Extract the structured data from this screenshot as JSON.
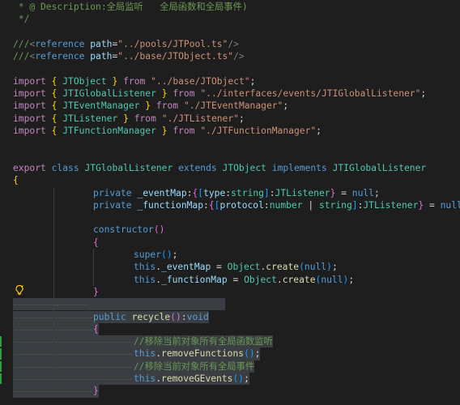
{
  "editor": {
    "lines": [
      {
        "name": "code-line-description",
        "tokens": [
          {
            "c": "c-comment",
            "t": " * @ Description:全局监听   全局函数和全局事件)"
          }
        ]
      },
      {
        "name": "code-line-comment-close",
        "tokens": [
          {
            "c": "c-comment",
            "t": " */"
          }
        ]
      },
      {
        "name": "code-line-blank",
        "tokens": []
      },
      {
        "name": "code-line-reference-pool",
        "tokens": [
          {
            "c": "c-comment",
            "t": "///"
          },
          {
            "c": "c-tag",
            "t": "<"
          },
          {
            "c": "c-storage",
            "t": "reference"
          },
          {
            "c": "c-plain",
            "t": " "
          },
          {
            "c": "c-attr",
            "t": "path"
          },
          {
            "c": "c-plain",
            "t": "="
          },
          {
            "c": "c-str",
            "t": "\"../pools/JTPool.ts\""
          },
          {
            "c": "c-tag",
            "t": "/>"
          }
        ]
      },
      {
        "name": "code-line-reference-object",
        "tokens": [
          {
            "c": "c-comment",
            "t": "///"
          },
          {
            "c": "c-tag",
            "t": "<"
          },
          {
            "c": "c-storage",
            "t": "reference"
          },
          {
            "c": "c-plain",
            "t": " "
          },
          {
            "c": "c-attr",
            "t": "path"
          },
          {
            "c": "c-plain",
            "t": "="
          },
          {
            "c": "c-str",
            "t": "\"../base/JTObject.ts\""
          },
          {
            "c": "c-tag",
            "t": "/>"
          }
        ]
      },
      {
        "name": "code-line-blank",
        "tokens": []
      },
      {
        "name": "code-line-import",
        "tokens": [
          {
            "c": "c-kw",
            "t": "import"
          },
          {
            "c": "c-plain",
            "t": " "
          },
          {
            "c": "c-br1",
            "t": "{"
          },
          {
            "c": "c-plain",
            "t": " "
          },
          {
            "c": "c-cls",
            "t": "JTObject"
          },
          {
            "c": "c-plain",
            "t": " "
          },
          {
            "c": "c-br1",
            "t": "}"
          },
          {
            "c": "c-plain",
            "t": " "
          },
          {
            "c": "c-kw",
            "t": "from"
          },
          {
            "c": "c-plain",
            "t": " "
          },
          {
            "c": "c-str",
            "t": "\"../base/JTObject\""
          },
          {
            "c": "c-plain",
            "t": ";"
          }
        ]
      },
      {
        "name": "code-line-import",
        "tokens": [
          {
            "c": "c-kw",
            "t": "import"
          },
          {
            "c": "c-plain",
            "t": " "
          },
          {
            "c": "c-br1",
            "t": "{"
          },
          {
            "c": "c-plain",
            "t": " "
          },
          {
            "c": "c-cls",
            "t": "JTIGlobalListener"
          },
          {
            "c": "c-plain",
            "t": " "
          },
          {
            "c": "c-br1",
            "t": "}"
          },
          {
            "c": "c-plain",
            "t": " "
          },
          {
            "c": "c-kw",
            "t": "from"
          },
          {
            "c": "c-plain",
            "t": " "
          },
          {
            "c": "c-str",
            "t": "\"../interfaces/events/JTIGlobalListener\""
          },
          {
            "c": "c-plain",
            "t": ";"
          }
        ]
      },
      {
        "name": "code-line-import",
        "tokens": [
          {
            "c": "c-kw",
            "t": "import"
          },
          {
            "c": "c-plain",
            "t": " "
          },
          {
            "c": "c-br1",
            "t": "{"
          },
          {
            "c": "c-plain",
            "t": " "
          },
          {
            "c": "c-cls",
            "t": "JTEventManager"
          },
          {
            "c": "c-plain",
            "t": " "
          },
          {
            "c": "c-br1",
            "t": "}"
          },
          {
            "c": "c-plain",
            "t": " "
          },
          {
            "c": "c-kw",
            "t": "from"
          },
          {
            "c": "c-plain",
            "t": " "
          },
          {
            "c": "c-str",
            "t": "\"./JTEventManager\""
          },
          {
            "c": "c-plain",
            "t": ";"
          }
        ]
      },
      {
        "name": "code-line-import",
        "tokens": [
          {
            "c": "c-kw",
            "t": "import"
          },
          {
            "c": "c-plain",
            "t": " "
          },
          {
            "c": "c-br1",
            "t": "{"
          },
          {
            "c": "c-plain",
            "t": " "
          },
          {
            "c": "c-cls",
            "t": "JTListener"
          },
          {
            "c": "c-plain",
            "t": " "
          },
          {
            "c": "c-br1",
            "t": "}"
          },
          {
            "c": "c-plain",
            "t": " "
          },
          {
            "c": "c-kw",
            "t": "from"
          },
          {
            "c": "c-plain",
            "t": " "
          },
          {
            "c": "c-str",
            "t": "\"./JTListener\""
          },
          {
            "c": "c-plain",
            "t": ";"
          }
        ]
      },
      {
        "name": "code-line-import",
        "tokens": [
          {
            "c": "c-kw",
            "t": "import"
          },
          {
            "c": "c-plain",
            "t": " "
          },
          {
            "c": "c-br1",
            "t": "{"
          },
          {
            "c": "c-plain",
            "t": " "
          },
          {
            "c": "c-cls",
            "t": "JTFunctionManager"
          },
          {
            "c": "c-plain",
            "t": " "
          },
          {
            "c": "c-br1",
            "t": "}"
          },
          {
            "c": "c-plain",
            "t": " "
          },
          {
            "c": "c-kw",
            "t": "from"
          },
          {
            "c": "c-plain",
            "t": " "
          },
          {
            "c": "c-str",
            "t": "\"./JTFunctionManager\""
          },
          {
            "c": "c-plain",
            "t": ";"
          }
        ]
      },
      {
        "name": "code-line-blank",
        "tokens": []
      },
      {
        "name": "code-line-blank",
        "tokens": []
      },
      {
        "name": "code-line-class-declaration",
        "tokens": [
          {
            "c": "c-kw",
            "t": "export"
          },
          {
            "c": "c-plain",
            "t": " "
          },
          {
            "c": "c-storage",
            "t": "class"
          },
          {
            "c": "c-plain",
            "t": " "
          },
          {
            "c": "c-cls",
            "t": "JTGlobalListener"
          },
          {
            "c": "c-plain",
            "t": " "
          },
          {
            "c": "c-storage",
            "t": "extends"
          },
          {
            "c": "c-plain",
            "t": " "
          },
          {
            "c": "c-cls",
            "t": "JTObject"
          },
          {
            "c": "c-plain",
            "t": " "
          },
          {
            "c": "c-storage",
            "t": "implements"
          },
          {
            "c": "c-plain",
            "t": " "
          },
          {
            "c": "c-cls",
            "t": "JTIGlobalListener"
          }
        ]
      },
      {
        "name": "code-line-class-open-brace",
        "tokens": [
          {
            "c": "c-br1",
            "t": "{"
          }
        ]
      },
      {
        "name": "code-line-event-map",
        "indent": 1,
        "tokens": [
          {
            "c": "c-storage",
            "t": "private"
          },
          {
            "c": "c-plain",
            "t": " "
          },
          {
            "c": "c-var",
            "t": "_eventMap"
          },
          {
            "c": "c-plain",
            "t": ":"
          },
          {
            "c": "c-br2",
            "t": "{"
          },
          {
            "c": "c-br3",
            "t": "["
          },
          {
            "c": "c-var",
            "t": "type"
          },
          {
            "c": "c-plain",
            "t": ":"
          },
          {
            "c": "c-cls",
            "t": "string"
          },
          {
            "c": "c-br3",
            "t": "]"
          },
          {
            "c": "c-plain",
            "t": ":"
          },
          {
            "c": "c-cls",
            "t": "JTListener"
          },
          {
            "c": "c-br2",
            "t": "}"
          },
          {
            "c": "c-plain",
            "t": " = "
          },
          {
            "c": "c-storage",
            "t": "null"
          },
          {
            "c": "c-plain",
            "t": ";"
          }
        ]
      },
      {
        "name": "code-line-function-map",
        "indent": 1,
        "tokens": [
          {
            "c": "c-storage",
            "t": "private"
          },
          {
            "c": "c-plain",
            "t": " "
          },
          {
            "c": "c-var",
            "t": "_functionMap"
          },
          {
            "c": "c-plain",
            "t": ":"
          },
          {
            "c": "c-br2",
            "t": "{"
          },
          {
            "c": "c-br3",
            "t": "["
          },
          {
            "c": "c-var",
            "t": "protocol"
          },
          {
            "c": "c-plain",
            "t": ":"
          },
          {
            "c": "c-cls",
            "t": "number"
          },
          {
            "c": "c-plain",
            "t": " | "
          },
          {
            "c": "c-cls",
            "t": "string"
          },
          {
            "c": "c-br3",
            "t": "]"
          },
          {
            "c": "c-plain",
            "t": ":"
          },
          {
            "c": "c-cls",
            "t": "JTListener"
          },
          {
            "c": "c-br2",
            "t": "}"
          },
          {
            "c": "c-plain",
            "t": " = "
          },
          {
            "c": "c-storage",
            "t": "null"
          },
          {
            "c": "c-plain",
            "t": ";"
          }
        ]
      },
      {
        "name": "code-line-blank",
        "tokens": []
      },
      {
        "name": "code-line-constructor",
        "indent": 1,
        "tokens": [
          {
            "c": "c-storage",
            "t": "constructor"
          },
          {
            "c": "c-br2",
            "t": "()"
          }
        ]
      },
      {
        "name": "code-line-constructor-open",
        "indent": 1,
        "tokens": [
          {
            "c": "c-br2",
            "t": "{"
          }
        ]
      },
      {
        "name": "code-line-super-call",
        "indent": 2,
        "tokens": [
          {
            "c": "c-storage",
            "t": "super"
          },
          {
            "c": "c-br3",
            "t": "()"
          },
          {
            "c": "c-plain",
            "t": ";"
          }
        ]
      },
      {
        "name": "code-line-event-map-create",
        "indent": 2,
        "tokens": [
          {
            "c": "c-this",
            "t": "this"
          },
          {
            "c": "c-plain",
            "t": "."
          },
          {
            "c": "c-var",
            "t": "_eventMap"
          },
          {
            "c": "c-plain",
            "t": " = "
          },
          {
            "c": "c-cls",
            "t": "Object"
          },
          {
            "c": "c-plain",
            "t": "."
          },
          {
            "c": "c-fn",
            "t": "create"
          },
          {
            "c": "c-br3",
            "t": "("
          },
          {
            "c": "c-storage",
            "t": "null"
          },
          {
            "c": "c-br3",
            "t": ")"
          },
          {
            "c": "c-plain",
            "t": ";"
          }
        ]
      },
      {
        "name": "code-line-function-map-create",
        "indent": 2,
        "tokens": [
          {
            "c": "c-this",
            "t": "this"
          },
          {
            "c": "c-plain",
            "t": "."
          },
          {
            "c": "c-var",
            "t": "_functionMap"
          },
          {
            "c": "c-plain",
            "t": " = "
          },
          {
            "c": "c-cls",
            "t": "Object"
          },
          {
            "c": "c-plain",
            "t": "."
          },
          {
            "c": "c-fn",
            "t": "create"
          },
          {
            "c": "c-br3",
            "t": "("
          },
          {
            "c": "c-storage",
            "t": "null"
          },
          {
            "c": "c-br3",
            "t": ")"
          },
          {
            "c": "c-plain",
            "t": ";"
          }
        ]
      },
      {
        "name": "code-line-constructor-close",
        "indent": 1,
        "tokens": [
          {
            "c": "c-br2",
            "t": "}"
          }
        ]
      },
      {
        "name": "code-line-blank-selected",
        "sel": true,
        "tokens": []
      },
      {
        "name": "code-line-recycle",
        "indent": 1,
        "sel": true,
        "tokens": [
          {
            "c": "c-storage",
            "t": "public"
          },
          {
            "c": "c-plain",
            "t": " "
          },
          {
            "c": "c-fn",
            "t": "recycle"
          },
          {
            "c": "c-br2",
            "t": "()"
          },
          {
            "c": "c-plain",
            "t": ":"
          },
          {
            "c": "c-storage",
            "t": "void"
          }
        ]
      },
      {
        "name": "code-line-recycle-open",
        "indent": 1,
        "sel": true,
        "tokens": [
          {
            "c": "c-br2",
            "t": "{"
          }
        ]
      },
      {
        "name": "code-line-comment-remove-functions",
        "indent": 2,
        "sel": true,
        "tokens": [
          {
            "c": "c-comment",
            "t": "//移除当前对象所有全局函数监听"
          }
        ]
      },
      {
        "name": "code-line-remove-functions",
        "indent": 2,
        "sel": true,
        "tokens": [
          {
            "c": "c-this",
            "t": "this"
          },
          {
            "c": "c-plain",
            "t": "."
          },
          {
            "c": "c-fn",
            "t": "removeFunctions"
          },
          {
            "c": "c-br3",
            "t": "()"
          },
          {
            "c": "c-plain",
            "t": ";"
          }
        ]
      },
      {
        "name": "code-line-comment-remove-events",
        "indent": 2,
        "sel": true,
        "tokens": [
          {
            "c": "c-comment",
            "t": "//移除当前对象所有全局事件"
          }
        ]
      },
      {
        "name": "code-line-remove-gevents",
        "indent": 2,
        "sel": true,
        "tokens": [
          {
            "c": "c-this",
            "t": "this"
          },
          {
            "c": "c-plain",
            "t": "."
          },
          {
            "c": "c-fn",
            "t": "removeGEvents"
          },
          {
            "c": "c-br3",
            "t": "()"
          },
          {
            "c": "c-plain",
            "t": ";"
          }
        ]
      },
      {
        "name": "code-line-recycle-close",
        "indent": 1,
        "sel": true,
        "tokens": [
          {
            "c": "c-br2",
            "t": "}"
          }
        ]
      }
    ]
  },
  "icons": {
    "lightbulb": "lightbulb-autofix-icon"
  },
  "colors": {
    "background": "#1e1e1e",
    "selection": "#3a3d41",
    "comment": "#6a9955",
    "keyword": "#c586c0",
    "storage": "#569cd6",
    "type": "#4ec9b0",
    "string": "#ce9178",
    "bracket_gold": "#ffd700",
    "bracket_orchid": "#da70d6",
    "bracket_blue": "#179fff",
    "variable": "#9cdcfe",
    "function": "#dcdcaa",
    "lightbulb": "#ffcc00"
  }
}
